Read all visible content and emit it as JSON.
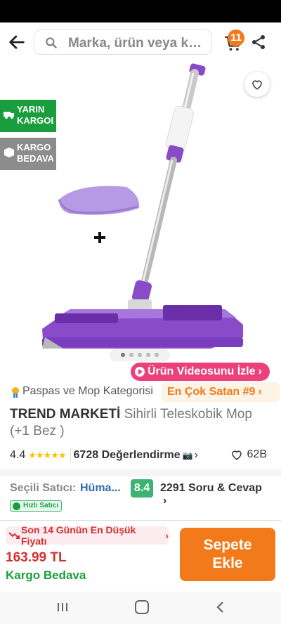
{
  "header": {
    "search_placeholder": "Marka, ürün veya kategori ara",
    "cart_count": "11"
  },
  "gallery": {
    "tags": [
      {
        "label": "YARIN KARGODA",
        "color": "#1a9e3d"
      },
      {
        "label": "KARGO BEDAVA",
        "color": "#8c8c8c"
      }
    ],
    "slide_count": 5,
    "active_slide": 1,
    "video_button": "Ürün Videosunu İzle"
  },
  "product": {
    "category": "Paspas ve Mop Kategorisi",
    "best_seller": "En Çok Satan #9",
    "brand": "TREND MARKETİ",
    "name": "Sihirli Teleskobik Mop (+1 Bez )",
    "rating": "4.4",
    "stars": "★★★★★",
    "reviews": "6728 Değerlendirme",
    "favorites": "62B"
  },
  "seller": {
    "label": "Seçili Satıcı:",
    "name": "Hüma...",
    "score": "8.4",
    "questions": "2291 Soru & Cevap",
    "fast_seller": "Hızlı Satıcı"
  },
  "purchase": {
    "lowest_price_note": "Son 14 Günün En Düşük Fiyatı",
    "price": "163.99 TL",
    "shipping": "Kargo Bedava",
    "add_to_cart": "Sepete Ekle"
  },
  "colors": {
    "accent": "#f27a1a",
    "price_red": "#d32f2f",
    "green": "#1a9e3d",
    "video_pink": "#ec407a",
    "mop_purple": "#8a4bc9"
  }
}
